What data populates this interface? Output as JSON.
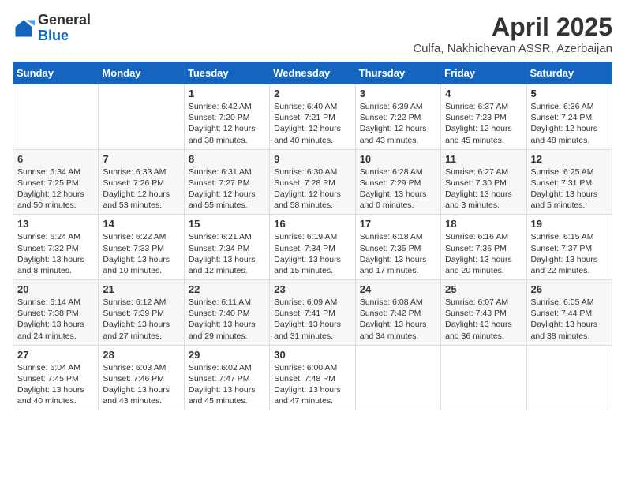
{
  "header": {
    "logo_general": "General",
    "logo_blue": "Blue",
    "month_title": "April 2025",
    "subtitle": "Culfa, Nakhichevan ASSR, Azerbaijan"
  },
  "weekdays": [
    "Sunday",
    "Monday",
    "Tuesday",
    "Wednesday",
    "Thursday",
    "Friday",
    "Saturday"
  ],
  "weeks": [
    [
      {
        "day": "",
        "sunrise": "",
        "sunset": "",
        "daylight": ""
      },
      {
        "day": "",
        "sunrise": "",
        "sunset": "",
        "daylight": ""
      },
      {
        "day": "1",
        "sunrise": "Sunrise: 6:42 AM",
        "sunset": "Sunset: 7:20 PM",
        "daylight": "Daylight: 12 hours and 38 minutes."
      },
      {
        "day": "2",
        "sunrise": "Sunrise: 6:40 AM",
        "sunset": "Sunset: 7:21 PM",
        "daylight": "Daylight: 12 hours and 40 minutes."
      },
      {
        "day": "3",
        "sunrise": "Sunrise: 6:39 AM",
        "sunset": "Sunset: 7:22 PM",
        "daylight": "Daylight: 12 hours and 43 minutes."
      },
      {
        "day": "4",
        "sunrise": "Sunrise: 6:37 AM",
        "sunset": "Sunset: 7:23 PM",
        "daylight": "Daylight: 12 hours and 45 minutes."
      },
      {
        "day": "5",
        "sunrise": "Sunrise: 6:36 AM",
        "sunset": "Sunset: 7:24 PM",
        "daylight": "Daylight: 12 hours and 48 minutes."
      }
    ],
    [
      {
        "day": "6",
        "sunrise": "Sunrise: 6:34 AM",
        "sunset": "Sunset: 7:25 PM",
        "daylight": "Daylight: 12 hours and 50 minutes."
      },
      {
        "day": "7",
        "sunrise": "Sunrise: 6:33 AM",
        "sunset": "Sunset: 7:26 PM",
        "daylight": "Daylight: 12 hours and 53 minutes."
      },
      {
        "day": "8",
        "sunrise": "Sunrise: 6:31 AM",
        "sunset": "Sunset: 7:27 PM",
        "daylight": "Daylight: 12 hours and 55 minutes."
      },
      {
        "day": "9",
        "sunrise": "Sunrise: 6:30 AM",
        "sunset": "Sunset: 7:28 PM",
        "daylight": "Daylight: 12 hours and 58 minutes."
      },
      {
        "day": "10",
        "sunrise": "Sunrise: 6:28 AM",
        "sunset": "Sunset: 7:29 PM",
        "daylight": "Daylight: 13 hours and 0 minutes."
      },
      {
        "day": "11",
        "sunrise": "Sunrise: 6:27 AM",
        "sunset": "Sunset: 7:30 PM",
        "daylight": "Daylight: 13 hours and 3 minutes."
      },
      {
        "day": "12",
        "sunrise": "Sunrise: 6:25 AM",
        "sunset": "Sunset: 7:31 PM",
        "daylight": "Daylight: 13 hours and 5 minutes."
      }
    ],
    [
      {
        "day": "13",
        "sunrise": "Sunrise: 6:24 AM",
        "sunset": "Sunset: 7:32 PM",
        "daylight": "Daylight: 13 hours and 8 minutes."
      },
      {
        "day": "14",
        "sunrise": "Sunrise: 6:22 AM",
        "sunset": "Sunset: 7:33 PM",
        "daylight": "Daylight: 13 hours and 10 minutes."
      },
      {
        "day": "15",
        "sunrise": "Sunrise: 6:21 AM",
        "sunset": "Sunset: 7:34 PM",
        "daylight": "Daylight: 13 hours and 12 minutes."
      },
      {
        "day": "16",
        "sunrise": "Sunrise: 6:19 AM",
        "sunset": "Sunset: 7:34 PM",
        "daylight": "Daylight: 13 hours and 15 minutes."
      },
      {
        "day": "17",
        "sunrise": "Sunrise: 6:18 AM",
        "sunset": "Sunset: 7:35 PM",
        "daylight": "Daylight: 13 hours and 17 minutes."
      },
      {
        "day": "18",
        "sunrise": "Sunrise: 6:16 AM",
        "sunset": "Sunset: 7:36 PM",
        "daylight": "Daylight: 13 hours and 20 minutes."
      },
      {
        "day": "19",
        "sunrise": "Sunrise: 6:15 AM",
        "sunset": "Sunset: 7:37 PM",
        "daylight": "Daylight: 13 hours and 22 minutes."
      }
    ],
    [
      {
        "day": "20",
        "sunrise": "Sunrise: 6:14 AM",
        "sunset": "Sunset: 7:38 PM",
        "daylight": "Daylight: 13 hours and 24 minutes."
      },
      {
        "day": "21",
        "sunrise": "Sunrise: 6:12 AM",
        "sunset": "Sunset: 7:39 PM",
        "daylight": "Daylight: 13 hours and 27 minutes."
      },
      {
        "day": "22",
        "sunrise": "Sunrise: 6:11 AM",
        "sunset": "Sunset: 7:40 PM",
        "daylight": "Daylight: 13 hours and 29 minutes."
      },
      {
        "day": "23",
        "sunrise": "Sunrise: 6:09 AM",
        "sunset": "Sunset: 7:41 PM",
        "daylight": "Daylight: 13 hours and 31 minutes."
      },
      {
        "day": "24",
        "sunrise": "Sunrise: 6:08 AM",
        "sunset": "Sunset: 7:42 PM",
        "daylight": "Daylight: 13 hours and 34 minutes."
      },
      {
        "day": "25",
        "sunrise": "Sunrise: 6:07 AM",
        "sunset": "Sunset: 7:43 PM",
        "daylight": "Daylight: 13 hours and 36 minutes."
      },
      {
        "day": "26",
        "sunrise": "Sunrise: 6:05 AM",
        "sunset": "Sunset: 7:44 PM",
        "daylight": "Daylight: 13 hours and 38 minutes."
      }
    ],
    [
      {
        "day": "27",
        "sunrise": "Sunrise: 6:04 AM",
        "sunset": "Sunset: 7:45 PM",
        "daylight": "Daylight: 13 hours and 40 minutes."
      },
      {
        "day": "28",
        "sunrise": "Sunrise: 6:03 AM",
        "sunset": "Sunset: 7:46 PM",
        "daylight": "Daylight: 13 hours and 43 minutes."
      },
      {
        "day": "29",
        "sunrise": "Sunrise: 6:02 AM",
        "sunset": "Sunset: 7:47 PM",
        "daylight": "Daylight: 13 hours and 45 minutes."
      },
      {
        "day": "30",
        "sunrise": "Sunrise: 6:00 AM",
        "sunset": "Sunset: 7:48 PM",
        "daylight": "Daylight: 13 hours and 47 minutes."
      },
      {
        "day": "",
        "sunrise": "",
        "sunset": "",
        "daylight": ""
      },
      {
        "day": "",
        "sunrise": "",
        "sunset": "",
        "daylight": ""
      },
      {
        "day": "",
        "sunrise": "",
        "sunset": "",
        "daylight": ""
      }
    ]
  ]
}
